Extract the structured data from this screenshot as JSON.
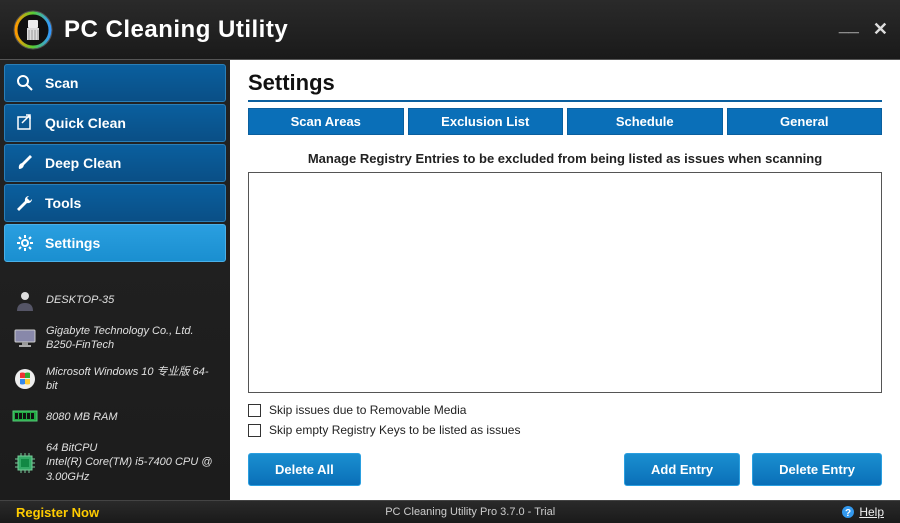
{
  "app": {
    "title": "PC Cleaning Utility"
  },
  "nav": {
    "scan": "Scan",
    "quick_clean": "Quick Clean",
    "deep_clean": "Deep Clean",
    "tools": "Tools",
    "settings": "Settings"
  },
  "sysinfo": {
    "computer": "DESKTOP-35",
    "board": "Gigabyte Technology Co., Ltd. B250-FinTech",
    "os": "Microsoft Windows 10 专业版 64-bit",
    "ram": "8080 MB RAM",
    "cpu": "64 BitCPU\nIntel(R) Core(TM) i5-7400 CPU @ 3.00GHz"
  },
  "page": {
    "title": "Settings",
    "tabs": {
      "scan_areas": "Scan Areas",
      "exclusion_list": "Exclusion List",
      "schedule": "Schedule",
      "general": "General"
    },
    "subtitle": "Manage Registry Entries to be excluded from being listed as issues when scanning",
    "checks": {
      "removable": "Skip issues due to Removable Media",
      "empty_keys": "Skip empty Registry Keys to be listed as issues"
    },
    "buttons": {
      "delete_all": "Delete All",
      "add_entry": "Add Entry",
      "delete_entry": "Delete Entry"
    }
  },
  "footer": {
    "register": "Register Now",
    "version": "PC Cleaning Utility Pro 3.7.0 - Trial",
    "help": "Help"
  }
}
